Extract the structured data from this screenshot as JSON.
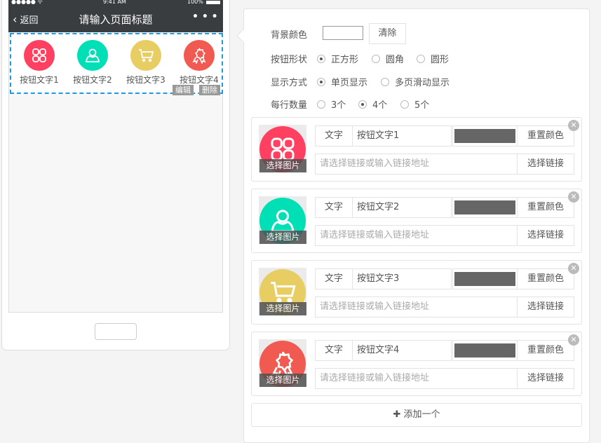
{
  "phone": {
    "status_left": "●●●●● ᯤ",
    "time": "9:41 AM",
    "battery": "100%",
    "back": "返回",
    "title": "请输入页面标题",
    "more": "• • •",
    "items": [
      {
        "label": "按钮文字1",
        "color": "#ff4060",
        "icon": "grid-icon"
      },
      {
        "label": "按钮文字2",
        "color": "#00dfb6",
        "icon": "user-icon"
      },
      {
        "label": "按钮文字3",
        "color": "#e8cd62",
        "icon": "cart-icon"
      },
      {
        "label": "按钮文字4",
        "color": "#f05a50",
        "icon": "award-icon"
      }
    ],
    "edit": "编辑",
    "delete": "删除"
  },
  "settings": {
    "bg_label": "背景颜色",
    "clear": "清除",
    "shape_label": "按钮形状",
    "shapes": [
      "正方形",
      "圆角",
      "圆形"
    ],
    "shape_selected": "正方形",
    "display_label": "显示方式",
    "displays": [
      "单页显示",
      "多页滑动显示"
    ],
    "display_selected": "单页显示",
    "per_row_label": "每行数量",
    "per_row": [
      "3个",
      "4个",
      "5个"
    ],
    "per_row_selected": "4个"
  },
  "cards": [
    {
      "text_label": "文字",
      "text": "按钮文字1",
      "swatch": "#666666",
      "reset": "重置颜色",
      "link_placeholder": "请选择链接或输入链接地址",
      "link_btn": "选择链接",
      "choose_img": "选择图片"
    },
    {
      "text_label": "文字",
      "text": "按钮文字2",
      "swatch": "#666666",
      "reset": "重置颜色",
      "link_placeholder": "请选择链接或输入链接地址",
      "link_btn": "选择链接",
      "choose_img": "选择图片"
    },
    {
      "text_label": "文字",
      "text": "按钮文字3",
      "swatch": "#666666",
      "reset": "重置颜色",
      "link_placeholder": "请选择链接或输入链接地址",
      "link_btn": "选择链接",
      "choose_img": "选择图片"
    },
    {
      "text_label": "文字",
      "text": "按钮文字4",
      "swatch": "#666666",
      "reset": "重置颜色",
      "link_placeholder": "请选择链接或输入链接地址",
      "link_btn": "选择链接",
      "choose_img": "选择图片"
    }
  ],
  "add": "✚ 添加一个"
}
